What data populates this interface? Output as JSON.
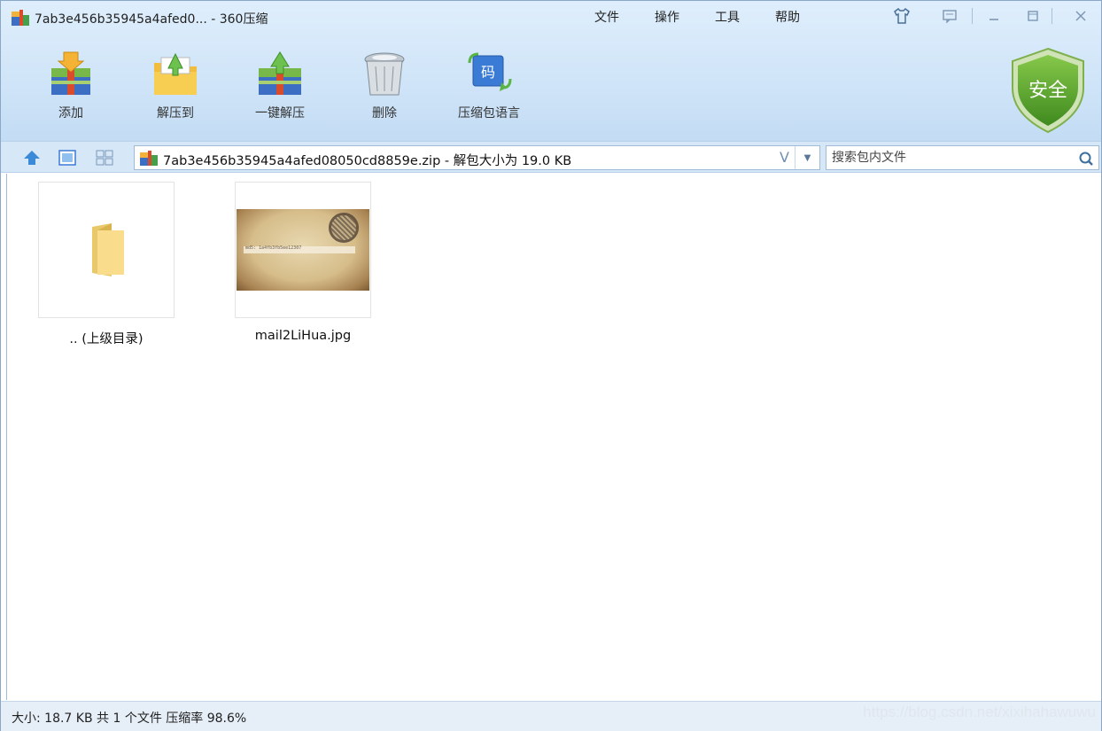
{
  "window": {
    "title": "7ab3e456b35945a4afed0... - 360压缩",
    "menu": [
      "文件",
      "操作",
      "工具",
      "帮助"
    ],
    "controls": [
      "skin-icon",
      "feedback-icon",
      "minimize-icon",
      "maximize-icon",
      "close-icon"
    ]
  },
  "toolbar": {
    "items": [
      {
        "label": "添加",
        "icon": "add-archive-icon"
      },
      {
        "label": "解压到",
        "icon": "extract-to-icon"
      },
      {
        "label": "一键解压",
        "icon": "one-click-extract-icon"
      },
      {
        "label": "删除",
        "icon": "delete-icon"
      },
      {
        "label": "压缩包语言",
        "icon": "archive-language-icon"
      }
    ],
    "security_badge": "安全"
  },
  "address": {
    "path": "7ab3e456b35945a4afed08050cd8859e.zip - 解包大小为 19.0 KB",
    "verify_mark": "V"
  },
  "search": {
    "placeholder": "搜索包内文件"
  },
  "files": [
    {
      "name": ".. (上级目录)",
      "icon": "folder-icon"
    },
    {
      "name": "mail2LiHua.jpg",
      "icon": "image-thumbnail",
      "preview_text": "md5: 1a4fb3fb5ee12307"
    }
  ],
  "status": {
    "text": "大小: 18.7 KB 共 1 个文件 压缩率 98.6%",
    "watermark": "https://blog.csdn.net/xixihahawuwu"
  },
  "colors": {
    "accent": "#3a7bd5",
    "toolbar_bg": "#cfe4f8",
    "shield_green": "#5aa32a"
  }
}
